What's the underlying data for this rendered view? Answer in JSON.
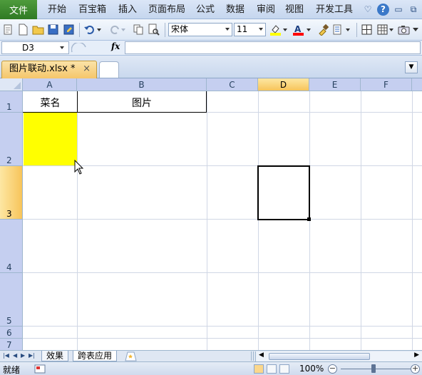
{
  "menu": {
    "file": "文件",
    "items": [
      "开始",
      "百宝箱",
      "插入",
      "页面布局",
      "公式",
      "数据",
      "审阅",
      "视图",
      "开发工具"
    ],
    "help": "?"
  },
  "toolbar": {
    "font_name": "宋体",
    "font_size": "11",
    "highlight_color": "#ffff00",
    "font_color": "#ff0000"
  },
  "formula_bar": {
    "name_box": "D3",
    "fx": "fx",
    "formula": ""
  },
  "doc_tab": {
    "title": "图片联动.xlsx *",
    "close": "×"
  },
  "grid": {
    "columns": [
      "A",
      "B",
      "C",
      "D",
      "E",
      "F"
    ],
    "active_column": "D",
    "rows": [
      "1",
      "2",
      "3",
      "4",
      "5",
      "6",
      "7"
    ],
    "active_row": "3",
    "cells": {
      "A1": "菜名",
      "B1": "图片"
    },
    "selected_cell": "D3",
    "highlight_fill": "#ffff00"
  },
  "sheets": {
    "tabs": [
      "效果",
      "跨表应用"
    ],
    "active": "跨表应用"
  },
  "status": {
    "text": "就绪",
    "zoom": "100%"
  }
}
